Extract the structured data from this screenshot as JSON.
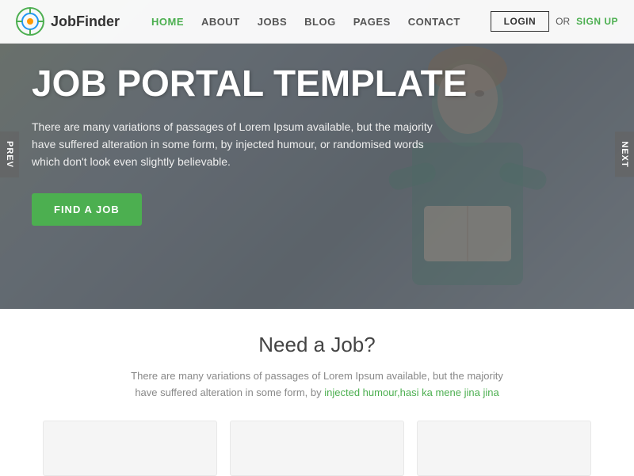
{
  "header": {
    "logo_text": "JobFinder",
    "nav_items": [
      {
        "label": "HOME",
        "active": true
      },
      {
        "label": "ABOUT",
        "active": false
      },
      {
        "label": "JOBS",
        "active": false
      },
      {
        "label": "BLOG",
        "active": false
      },
      {
        "label": "PAGES",
        "active": false
      },
      {
        "label": "CONTACT",
        "active": false
      }
    ],
    "login_label": "LOGIN",
    "or_label": "OR",
    "signup_label": "SIGN UP"
  },
  "hero": {
    "title": "JOB PORTAL TEMPLATE",
    "description": "There are many variations of passages of Lorem Ipsum available, but the majority have suffered alteration in some form, by injected humour, or randomised words which don't look even slightly believable.",
    "cta_label": "FIND A JOB",
    "prev_label": "PREV",
    "next_label": "NEXT"
  },
  "section": {
    "title": "Need a Job?",
    "description": "There are many variations of passages of Lorem Ipsum available, but the majority have suffered alteration in some form, by",
    "description_link": "injected humour,hasi ka mene jina jina"
  },
  "colors": {
    "accent": "#4CAF50"
  }
}
